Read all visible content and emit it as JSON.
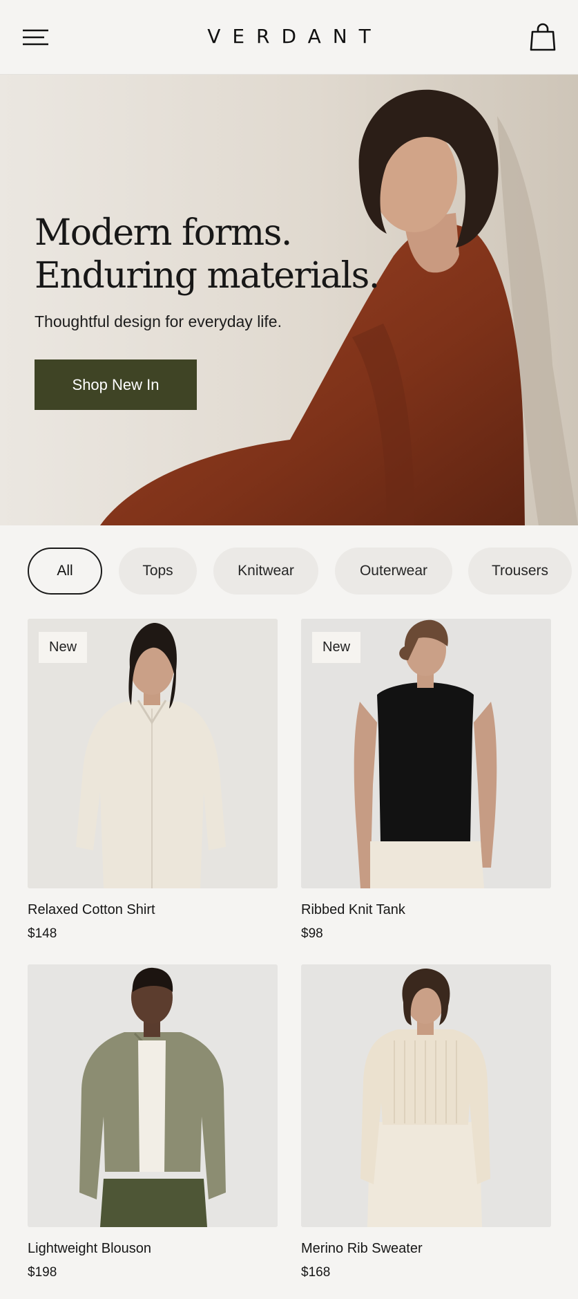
{
  "header": {
    "brand": "VERDANT",
    "menu_icon": "hamburger-menu-icon",
    "bag_icon": "shopping-bag-icon"
  },
  "hero": {
    "title_line1": "Modern forms.",
    "title_line2": "Enduring materials.",
    "subtitle": "Thoughtful design for everyday life.",
    "cta_label": "Shop New In",
    "accent": "#3f4425"
  },
  "filters": [
    {
      "label": "All",
      "active": true
    },
    {
      "label": "Tops",
      "active": false
    },
    {
      "label": "Knitwear",
      "active": false
    },
    {
      "label": "Outerwear",
      "active": false
    },
    {
      "label": "Trousers",
      "active": false
    }
  ],
  "products": [
    {
      "name": "Relaxed Cotton Shirt",
      "price": "$148",
      "badge": "New"
    },
    {
      "name": "Ribbed Knit Tank",
      "price": "$98",
      "badge": "New"
    },
    {
      "name": "Lightweight Blouson",
      "price": "$198",
      "badge": ""
    },
    {
      "name": "Merino Rib Sweater",
      "price": "$168",
      "badge": ""
    }
  ]
}
